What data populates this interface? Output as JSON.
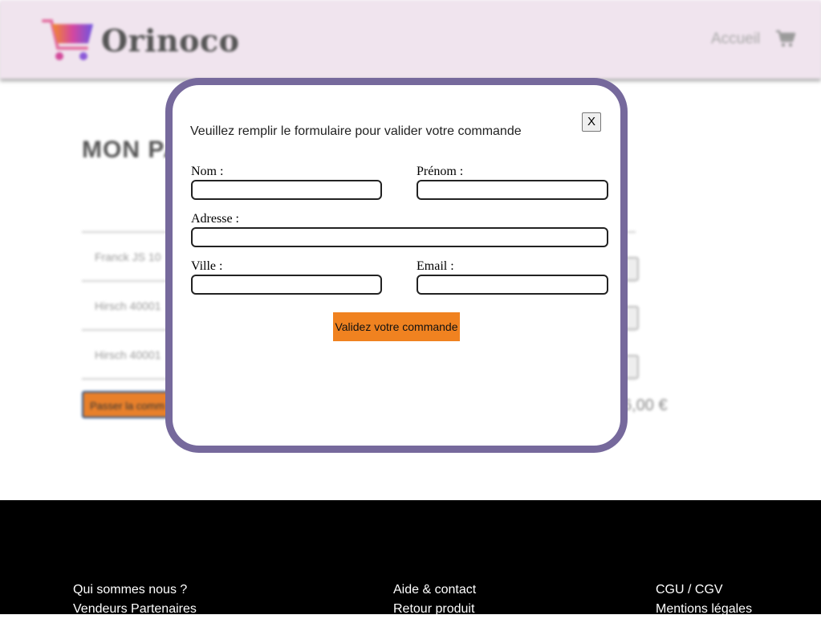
{
  "header": {
    "brand": "Orinoco",
    "nav_home": "Accueil",
    "cart_icon": "shopping-cart-icon"
  },
  "cart_page": {
    "title": "MON PA",
    "rows": [
      {
        "name": "Franck JS 10"
      },
      {
        "name": "Hirsch 40001"
      },
      {
        "name": "Hirsch 40001"
      }
    ],
    "order_button": "Passer la comm",
    "total": "6,00 €"
  },
  "modal": {
    "title": "Veuillez remplir le formulaire pour valider votre commande",
    "close_label": "X",
    "fields": {
      "nom": {
        "label": "Nom :",
        "value": ""
      },
      "prenom": {
        "label": "Prénom :",
        "value": ""
      },
      "adresse": {
        "label": "Adresse :",
        "value": ""
      },
      "ville": {
        "label": "Ville :",
        "value": ""
      },
      "email": {
        "label": "Email :",
        "value": ""
      }
    },
    "submit_label": "Validez votre commande"
  },
  "footer": {
    "col1": [
      "Qui sommes nous ?",
      "Vendeurs Partenaires"
    ],
    "col2": [
      "Aide & contact",
      "Retour produit"
    ],
    "col3": [
      "CGU / CGV",
      "Mentions légales"
    ]
  },
  "colors": {
    "header_bg": "#f0e4ee",
    "modal_border": "#76699c",
    "accent_orange": "#f08220",
    "footer_bg": "#000000"
  }
}
